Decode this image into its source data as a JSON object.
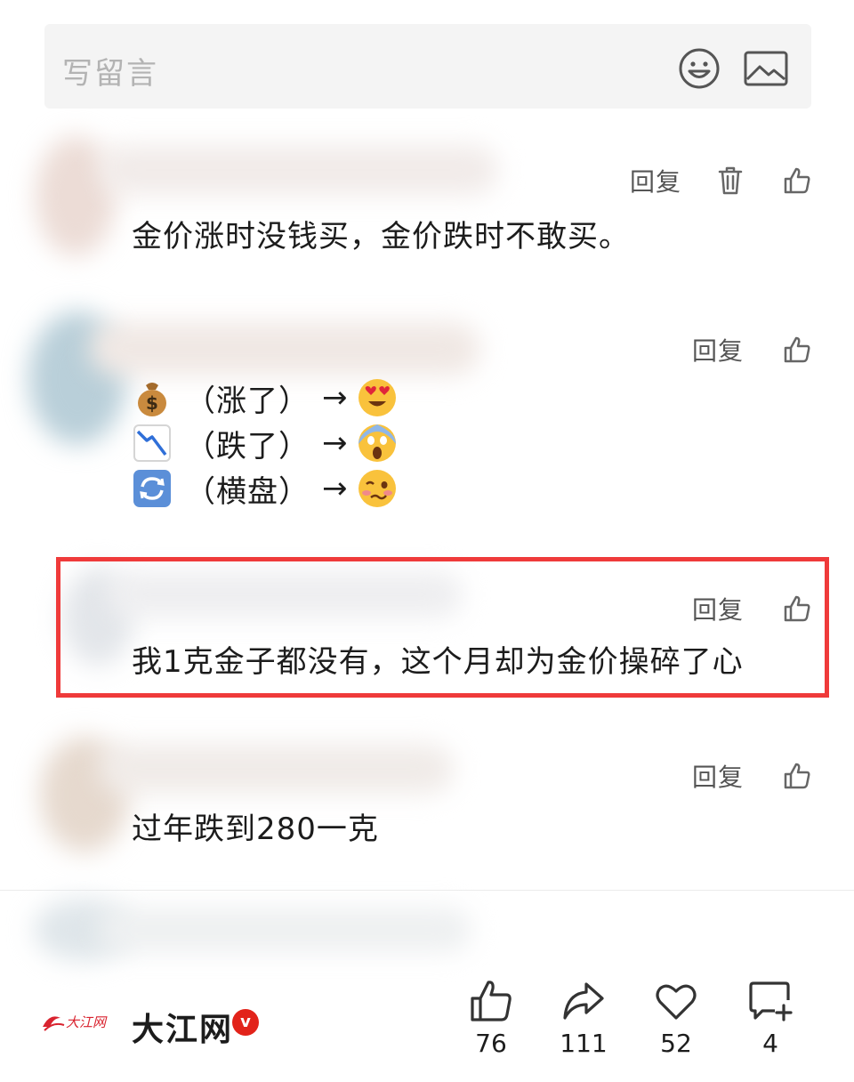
{
  "comment_input": {
    "placeholder": "写留言",
    "emoji_icon": "smiley-icon",
    "image_icon": "image-icon"
  },
  "comments": [
    {
      "reply_label": "回复",
      "text": "金价涨时没钱买，金价跌时不敢买。",
      "has_delete": true
    },
    {
      "reply_label": "回复",
      "lines": [
        {
          "icon": "money-bag",
          "text": "（涨了）",
          "arrow": "→",
          "reaction": "heart-eyes"
        },
        {
          "icon": "chart-decreasing",
          "text": "（跌了）",
          "arrow": "→",
          "reaction": "screaming-face"
        },
        {
          "icon": "counterclockwise-arrows",
          "text": "（横盘）",
          "arrow": "→",
          "reaction": "woozy-face"
        }
      ]
    },
    {
      "reply_label": "回复",
      "text": "我1克金子都没有，这个月却为金价操碎了心",
      "highlighted": true
    },
    {
      "reply_label": "回复",
      "text": "过年跌到280一克"
    }
  ],
  "footer": {
    "brand_name": "大江网",
    "logo_text": "大江网",
    "verified_mark": "v",
    "likes": "76",
    "shares": "111",
    "favorites": "52",
    "comments": "4"
  },
  "colors": {
    "highlight_border": "#ef3a3a",
    "verified": "#e2231a",
    "icon_gray": "#666666"
  }
}
